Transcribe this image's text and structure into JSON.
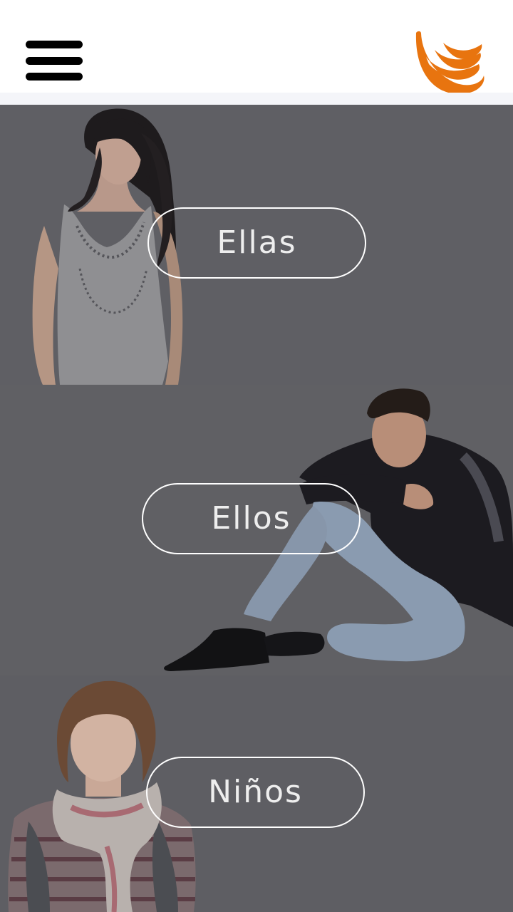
{
  "header": {
    "menu_icon": "hamburger-menu-icon",
    "logo_icon": "banana-logo-icon",
    "accent_color": "#e8740f"
  },
  "sections": [
    {
      "id": "ellas",
      "label": "Ellas"
    },
    {
      "id": "ellos",
      "label": "Ellos"
    },
    {
      "id": "ninos",
      "label": "Niños"
    }
  ]
}
